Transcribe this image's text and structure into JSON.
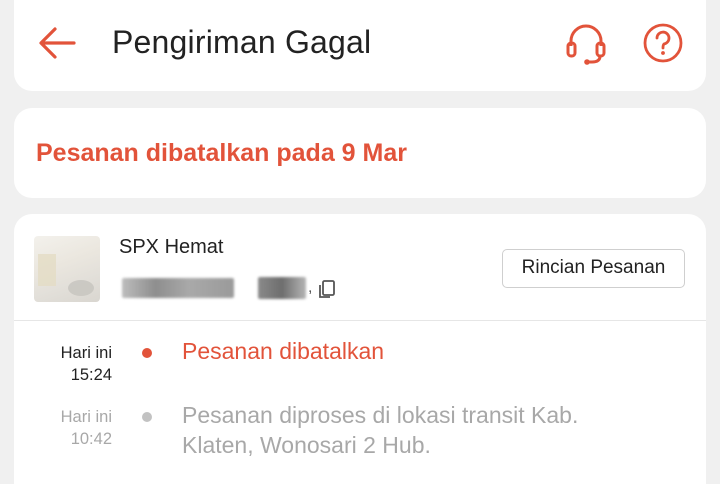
{
  "header": {
    "title": "Pengiriman Gagal",
    "back_icon": "back-arrow-icon",
    "support_icon": "headset-icon",
    "help_icon": "question-circle-icon"
  },
  "status": {
    "text": "Pesanan dibatalkan pada 9 Mar"
  },
  "shipment": {
    "courier": "SPX Hemat",
    "tracking_number_masked": true,
    "tracking_suffix": ",",
    "detail_button_label": "Rincian Pesanan",
    "copy_icon": "copy-icon"
  },
  "timeline": [
    {
      "day": "Hari ini",
      "time": "15:24",
      "text": "Pesanan dibatalkan",
      "active": true
    },
    {
      "day": "Hari ini",
      "time": "10:42",
      "text": "Pesanan diproses di lokasi transit Kab. Klaten, Wonosari 2 Hub.",
      "active": false
    }
  ],
  "colors": {
    "accent": "#e2533a",
    "inactive_text": "#a8a8a8",
    "background": "#f0f0f0"
  }
}
